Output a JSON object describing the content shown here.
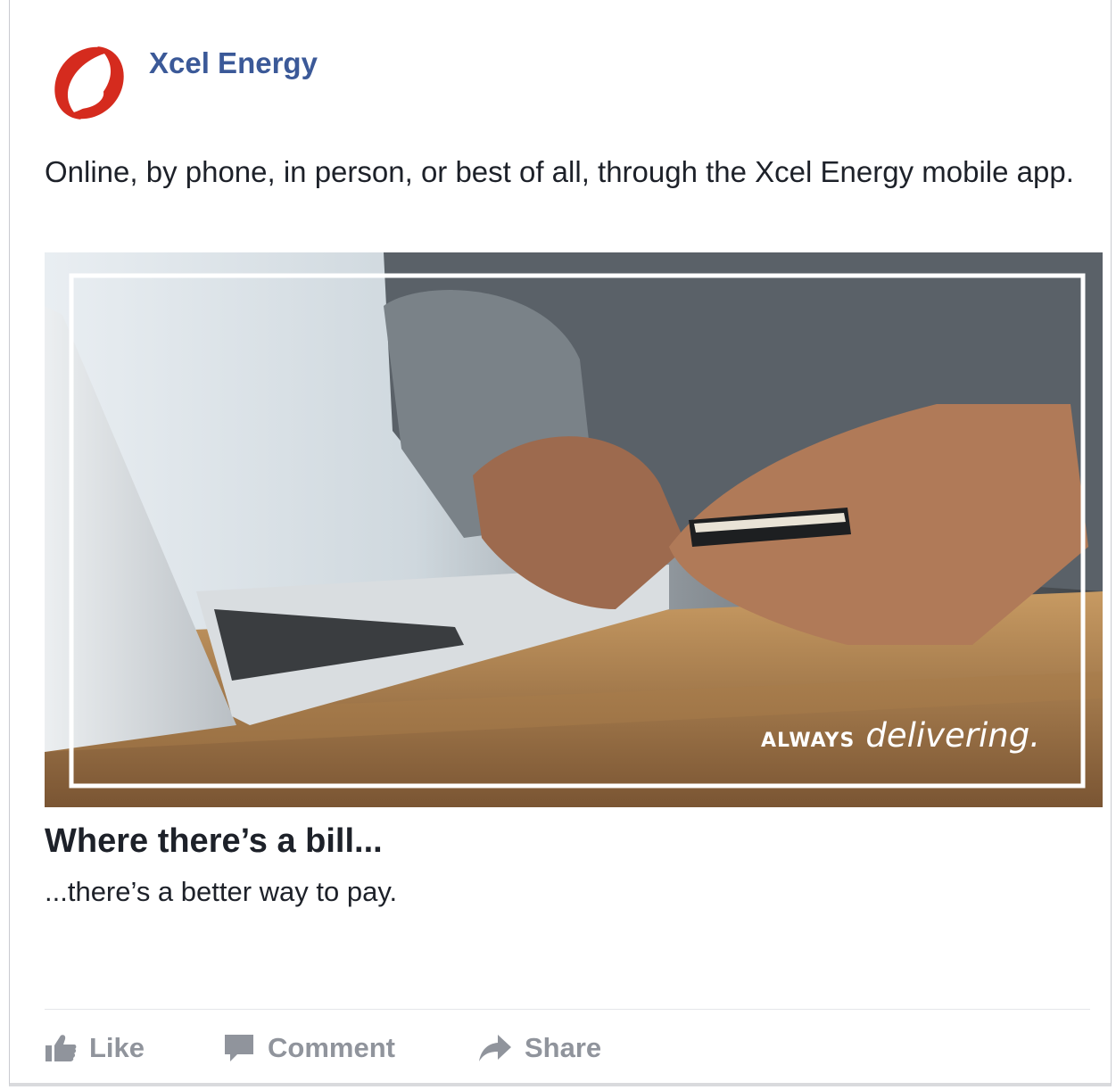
{
  "post": {
    "page_name": "Xcel Energy",
    "logo_icon": "xcel-energy-logo",
    "brand_color": "#d52b1e",
    "link_color": "#3b5998",
    "text": "Online, by phone, in person, or best of all, through the Xcel Energy mobile app."
  },
  "media": {
    "tagline_prefix": "ALWAYS",
    "tagline_word": "delivering."
  },
  "link_preview": {
    "title": "Where there’s a bill...",
    "description": "...there’s a better way to pay."
  },
  "actions": {
    "like": {
      "label": "Like",
      "icon": "thumbs-up-icon"
    },
    "comment": {
      "label": "Comment",
      "icon": "comment-icon"
    },
    "share": {
      "label": "Share",
      "icon": "share-arrow-icon"
    }
  }
}
